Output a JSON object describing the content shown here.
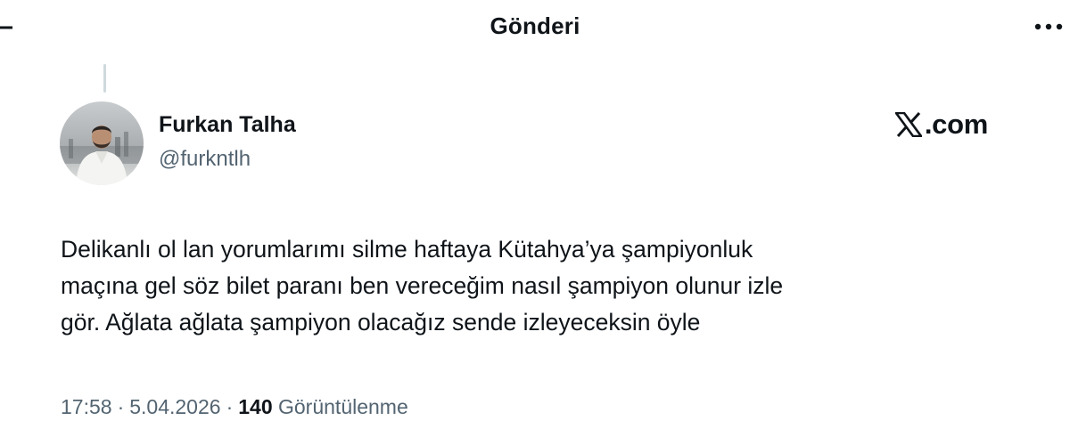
{
  "header": {
    "title": "Gönderi",
    "back_icon": "arrow-left-icon",
    "more_icon": "more-horizontal-icon"
  },
  "tweet": {
    "author": {
      "display_name": "Furkan Talha",
      "handle": "@furkntlh"
    },
    "brand": {
      "logo_icon": "x-logo-icon",
      "text": ".com"
    },
    "text_lines": [
      "Delikanlı ol lan yorumlarımı silme haftaya Kütahya’ya şampiyonluk",
      "maçına gel söz bilet paranı ben vereceğim nasıl şampiyon olunur izle",
      "gör. Ağlata ağlata şampiyon olacağız sende izleyeceksin öyle"
    ],
    "meta": {
      "time": "17:58",
      "separator": "·",
      "date": "5.04.2026",
      "views_count": "140",
      "views_label": "Görüntülenme"
    }
  },
  "colors": {
    "text_primary": "#0f1419",
    "text_secondary": "#536471",
    "thread_line": "#cfd9de",
    "background": "#ffffff"
  }
}
